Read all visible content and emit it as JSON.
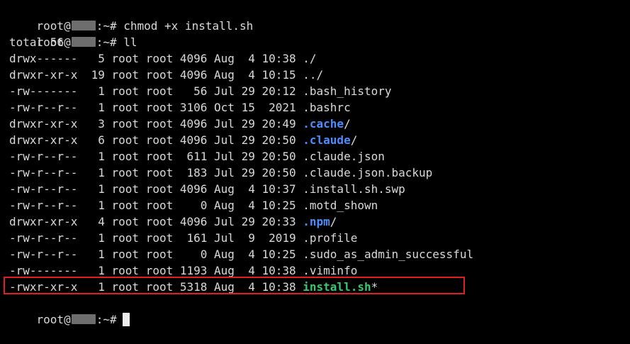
{
  "colors": {
    "background": "#000000",
    "text": "#d9d9d9",
    "directory": "#4c8dff",
    "executable": "#35c96e",
    "highlight": "#e02020",
    "redaction": "#6e6e6e"
  },
  "prompt": {
    "user": "root@",
    "suffix": ":~#"
  },
  "commands": [
    "chmod +x install.sh",
    "ll"
  ],
  "total_line": "total 56",
  "listing": [
    {
      "perms": "drwx------ ",
      "links": " 5",
      "owner": "root",
      "group": "root",
      "size": "4096",
      "date": "Aug  4 10:38",
      "name": ".",
      "name_style": "dir-plain",
      "suffix": "/"
    },
    {
      "perms": "drwxr-xr-x ",
      "links": "19",
      "owner": "root",
      "group": "root",
      "size": "4096",
      "date": "Aug  4 10:15",
      "name": "..",
      "name_style": "dir-plain",
      "suffix": "/"
    },
    {
      "perms": "-rw------- ",
      "links": " 1",
      "owner": "root",
      "group": "root",
      "size": "  56",
      "date": "Jul 29 20:12",
      "name": ".bash_history",
      "name_style": "",
      "suffix": ""
    },
    {
      "perms": "-rw-r--r-- ",
      "links": " 1",
      "owner": "root",
      "group": "root",
      "size": "3106",
      "date": "Oct 15  2021",
      "name": ".bashrc",
      "name_style": "",
      "suffix": ""
    },
    {
      "perms": "drwxr-xr-x ",
      "links": " 3",
      "owner": "root",
      "group": "root",
      "size": "4096",
      "date": "Jul 29 20:49",
      "name": ".cache",
      "name_style": "dir-blue",
      "suffix": "/"
    },
    {
      "perms": "drwxr-xr-x ",
      "links": " 6",
      "owner": "root",
      "group": "root",
      "size": "4096",
      "date": "Jul 29 20:50",
      "name": ".claude",
      "name_style": "dir-blue",
      "suffix": "/"
    },
    {
      "perms": "-rw-r--r-- ",
      "links": " 1",
      "owner": "root",
      "group": "root",
      "size": " 611",
      "date": "Jul 29 20:50",
      "name": ".claude.json",
      "name_style": "",
      "suffix": ""
    },
    {
      "perms": "-rw-r--r-- ",
      "links": " 1",
      "owner": "root",
      "group": "root",
      "size": " 183",
      "date": "Jul 29 20:50",
      "name": ".claude.json.backup",
      "name_style": "",
      "suffix": ""
    },
    {
      "perms": "-rw-r--r-- ",
      "links": " 1",
      "owner": "root",
      "group": "root",
      "size": "4096",
      "date": "Aug  4 10:37",
      "name": ".install.sh.swp",
      "name_style": "",
      "suffix": ""
    },
    {
      "perms": "-rw-r--r-- ",
      "links": " 1",
      "owner": "root",
      "group": "root",
      "size": "   0",
      "date": "Aug  4 10:25",
      "name": ".motd_shown",
      "name_style": "",
      "suffix": ""
    },
    {
      "perms": "drwxr-xr-x ",
      "links": " 4",
      "owner": "root",
      "group": "root",
      "size": "4096",
      "date": "Jul 29 20:33",
      "name": ".npm",
      "name_style": "dir-blue",
      "suffix": "/"
    },
    {
      "perms": "-rw-r--r-- ",
      "links": " 1",
      "owner": "root",
      "group": "root",
      "size": " 161",
      "date": "Jul  9  2019",
      "name": ".profile",
      "name_style": "",
      "suffix": ""
    },
    {
      "perms": "-rw-r--r-- ",
      "links": " 1",
      "owner": "root",
      "group": "root",
      "size": "   0",
      "date": "Aug  4 10:25",
      "name": ".sudo_as_admin_successful",
      "name_style": "",
      "suffix": ""
    },
    {
      "perms": "-rw------- ",
      "links": " 1",
      "owner": "root",
      "group": "root",
      "size": "1193",
      "date": "Aug  4 10:38",
      "name": ".viminfo",
      "name_style": "",
      "suffix": ""
    },
    {
      "perms": "-rwxr-xr-x ",
      "links": " 1",
      "owner": "root",
      "group": "root",
      "size": "5318",
      "date": "Aug  4 10:38",
      "name": "install.sh",
      "name_style": "exec-green",
      "suffix": "*",
      "highlighted": true
    }
  ]
}
